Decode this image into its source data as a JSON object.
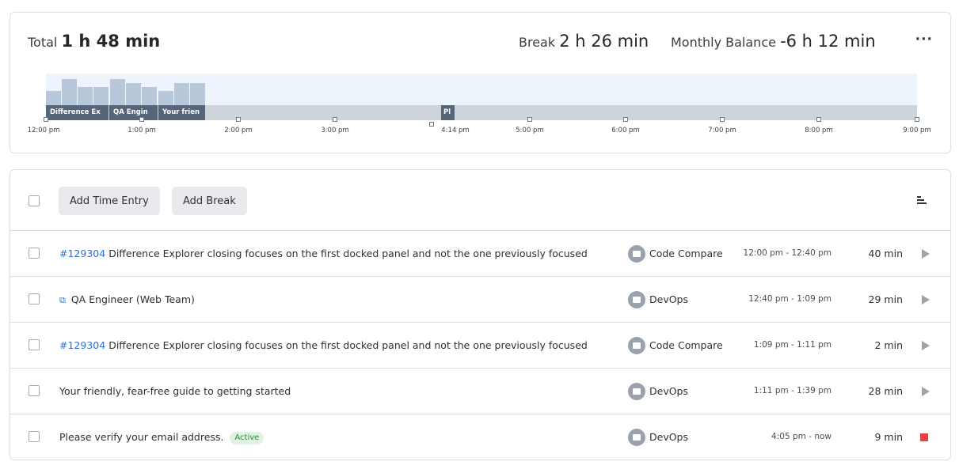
{
  "summary": {
    "total_label": "Total",
    "total_value": "1 h 48 min",
    "break_label": "Break",
    "break_value": "2 h 26 min",
    "balance_label": "Monthly Balance",
    "balance_value": "-6 h 12 min",
    "more_icon": "more-horizontal-icon",
    "more_glyph": "···"
  },
  "timeline": {
    "segments": [
      {
        "label": "Difference Ex"
      },
      {
        "label": "QA Engin"
      },
      {
        "label": "Your frien"
      },
      {
        "label": "Pl"
      }
    ],
    "hour_labels": [
      "12:00 pm",
      "1:00 pm",
      "2:00 pm",
      "3:00 pm",
      "4:14 pm",
      "5:00 pm",
      "6:00 pm",
      "7:00 pm",
      "8:00 pm",
      "9:00 pm"
    ],
    "colors": {
      "segment": "#56657a",
      "track": "#cfd4da",
      "bars": "#b8c8da",
      "background": "#eef4fc"
    }
  },
  "toolbar": {
    "add_time_entry": "Add Time Entry",
    "add_break": "Add Break",
    "sort_icon": "sort-lines-icon"
  },
  "entries": [
    {
      "issue": "#129304",
      "title": "Difference Explorer closing focuses on the first docked panel and not the one previously focused",
      "project": "Code Compare",
      "time": "12:00 pm - 12:40 pm",
      "duration": "40 min",
      "action": "play"
    },
    {
      "external": true,
      "title": "QA Engineer (Web Team)",
      "project": "DevOps",
      "time": "12:40 pm - 1:09 pm",
      "duration": "29 min",
      "action": "play"
    },
    {
      "issue": "#129304",
      "title": "Difference Explorer closing focuses on the first docked panel and not the one previously focused",
      "project": "Code Compare",
      "time": "1:09 pm - 1:11 pm",
      "duration": "2 min",
      "action": "play"
    },
    {
      "title": "Your friendly, fear-free guide to getting started",
      "project": "DevOps",
      "time": "1:11 pm - 1:39 pm",
      "duration": "28 min",
      "action": "play"
    },
    {
      "title": "Please verify your email address.",
      "badge": "Active",
      "project": "DevOps",
      "time": "4:05 pm - now",
      "duration": "9 min",
      "action": "stop"
    }
  ],
  "colors": {
    "link": "#2f6fd6",
    "stop": "#e8433e",
    "active_badge_bg": "#dff3e2",
    "active_badge_text": "#2e8b3d"
  }
}
